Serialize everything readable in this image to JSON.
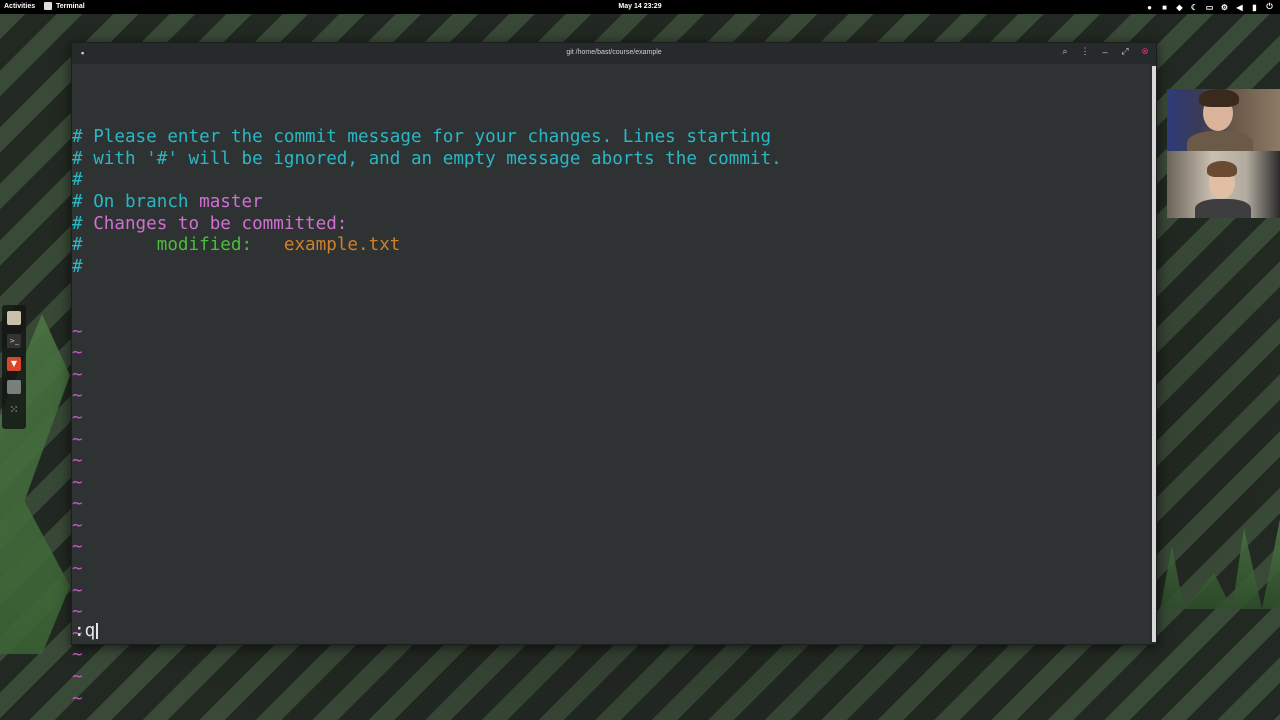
{
  "topbar": {
    "activities": "Activities",
    "app_name": "Terminal",
    "clock": "May 14 23:29"
  },
  "window": {
    "title": "git /home/bast/course/example"
  },
  "editor": {
    "lines": [
      {
        "parts": [
          {
            "text": "# ",
            "color": "c-cyan"
          },
          {
            "text": "Please enter the commit message for your changes. Lines starting",
            "color": "c-cyan"
          }
        ]
      },
      {
        "parts": [
          {
            "text": "# ",
            "color": "c-cyan"
          },
          {
            "text": "with '#' will be ignored, and an empty message aborts the commit.",
            "color": "c-cyan"
          }
        ]
      },
      {
        "parts": [
          {
            "text": "#",
            "color": "c-cyan"
          }
        ]
      },
      {
        "parts": [
          {
            "text": "# ",
            "color": "c-cyan"
          },
          {
            "text": "On branch ",
            "color": "c-cyan"
          },
          {
            "text": "master",
            "color": "c-pink"
          }
        ]
      },
      {
        "parts": [
          {
            "text": "# ",
            "color": "c-cyan"
          },
          {
            "text": "Changes to be committed:",
            "color": "c-pink"
          }
        ]
      },
      {
        "parts": [
          {
            "text": "#       ",
            "color": "c-cyan"
          },
          {
            "text": "modified:",
            "color": "c-green"
          },
          {
            "text": "   ",
            "color": "c-cyan"
          },
          {
            "text": "example.txt",
            "color": "c-orange"
          }
        ]
      },
      {
        "parts": [
          {
            "text": "#",
            "color": "c-cyan"
          }
        ]
      }
    ],
    "tilde_char": "~",
    "tilde_count": 18,
    "command": ":q"
  }
}
